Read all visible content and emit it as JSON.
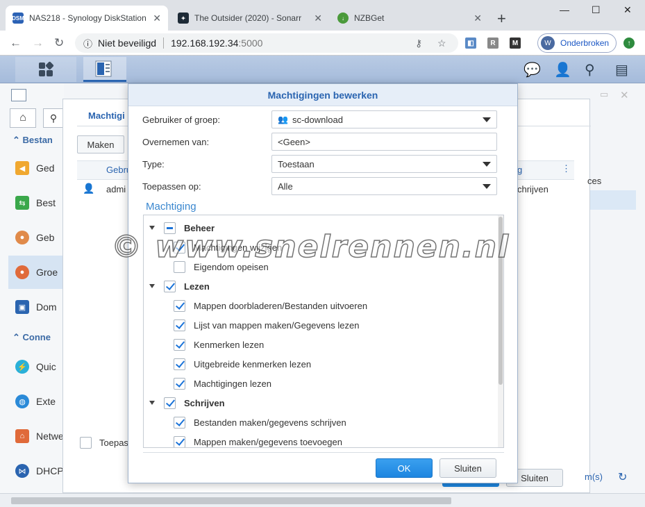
{
  "browser": {
    "tabs": [
      {
        "label": "NAS218 - Synology DiskStation",
        "favicon": "DSM"
      },
      {
        "label": "The Outsider (2020) - Sonarr",
        "favicon": "sonarr-icon"
      },
      {
        "label": "NZBGet",
        "favicon": "nzbget-icon"
      }
    ],
    "security_label": "Niet beveiligd",
    "url_host": "192.168.192.34",
    "url_port": ":5000",
    "profile_initial": "W",
    "profile_label": "Onderbroken"
  },
  "background": {
    "sidebar": {
      "heading1": "Bestan",
      "heading2": "Conne",
      "items": [
        "Ged",
        "Best",
        "Geb",
        "Groe",
        "Dom",
        "Quic",
        "Exte",
        "Netwe",
        "DHCP"
      ]
    },
    "tab_label": "Machtigi",
    "create_button": "Maken",
    "column_header": "Gebru",
    "row_user": "admi",
    "right_col_header": "g",
    "right_row_value": "chrijven",
    "right_text_ces": "ces",
    "apply_checkbox_label": "Toepass",
    "close_button": "Sluiten",
    "footer_link": "m(s)"
  },
  "dialog": {
    "title": "Machtigingen bewerken",
    "user_or_group_label": "Gebruiker of groep:",
    "user_or_group_value": "sc-download",
    "inherit_label": "Overnemen van:",
    "inherit_value": "<Geen>",
    "type_label": "Type:",
    "type_value": "Toestaan",
    "apply_to_label": "Toepassen op:",
    "apply_to_value": "Alle",
    "permission_section": "Machtiging",
    "groups": [
      {
        "label": "Beheer",
        "state": "partial",
        "items": [
          {
            "label": "Machtigingen wijzigen",
            "checked": true
          },
          {
            "label": "Eigendom opeisen",
            "checked": false
          }
        ]
      },
      {
        "label": "Lezen",
        "state": "checked",
        "items": [
          {
            "label": "Mappen doorbladeren/Bestanden uitvoeren",
            "checked": true
          },
          {
            "label": "Lijst van mappen maken/Gegevens lezen",
            "checked": true
          },
          {
            "label": "Kenmerken lezen",
            "checked": true
          },
          {
            "label": "Uitgebreide kenmerken lezen",
            "checked": true
          },
          {
            "label": "Machtigingen lezen",
            "checked": true
          }
        ]
      },
      {
        "label": "Schrijven",
        "state": "checked",
        "items": [
          {
            "label": "Bestanden maken/gegevens schrijven",
            "checked": true
          },
          {
            "label": "Mappen maken/gegevens toevoegen",
            "checked": true
          }
        ]
      }
    ],
    "ok_button": "OK",
    "close_button": "Sluiten"
  },
  "watermark": "© www.snelrennen.nl",
  "colors": {
    "accent": "#1a73d9",
    "title": "#2a64b0",
    "section": "#3a87cf"
  }
}
